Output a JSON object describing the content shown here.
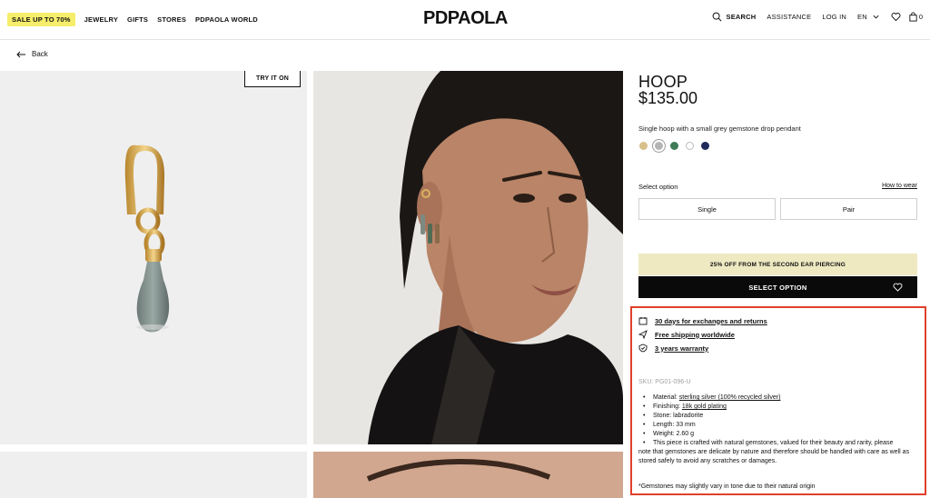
{
  "header": {
    "sale_badge": "SALE UP TO 70%",
    "nav": [
      "JEWELRY",
      "GIFTS",
      "STORES",
      "PDPAOLA WORLD"
    ],
    "logo": "PDPAOLA",
    "search_label": "SEARCH",
    "assistance": "ASSISTANCE",
    "login": "LOG IN",
    "language": "EN",
    "cart_count": "0"
  },
  "back_label": "Back",
  "gallery": {
    "try_on_label": "TRY IT ON"
  },
  "product": {
    "title": "HOOP",
    "price": "$135.00",
    "description": "Single hoop with a small grey gemstone drop pendant",
    "swatches": [
      "#d8c08c",
      "#b5b5b5",
      "#3f7a57",
      "#ffffff",
      "#1f2a5c"
    ],
    "selected_swatch": 1,
    "select_option_label": "Select option",
    "how_to_wear": "How to wear",
    "options": [
      "Single",
      "Pair"
    ],
    "promo": "25% OFF FROM THE SECOND EAR PIERCING",
    "select_button": "SELECT OPTION",
    "benefits": [
      "30 days for exchanges and returns",
      "Free shipping worldwide",
      "3 years warranty"
    ],
    "sku": "SKU: PG01-096-U",
    "specs": {
      "material_label": "Material: ",
      "material_value": "sterling silver (100% recycled silver)",
      "finishing_label": "Finishing: ",
      "finishing_value": "18k gold plating",
      "stone": "Stone: labradorite",
      "length": "Length: 33 mm",
      "weight": "Weight: 2.60 g",
      "note_start": "This piece is crafted with natural gemstones, valued for their beauty and rarity, please",
      "note_rest": "note that gemstones are delicate by nature and therefore should be handled with care as well as stored safely to avoid any scratches or damages."
    },
    "footnote": "*Gemstones may slightly vary in tone due to their natural origin"
  },
  "colors": {
    "highlight": "#e0402a",
    "sale_yellow": "#f6ee6b",
    "promo_bg": "#efe9c2"
  }
}
